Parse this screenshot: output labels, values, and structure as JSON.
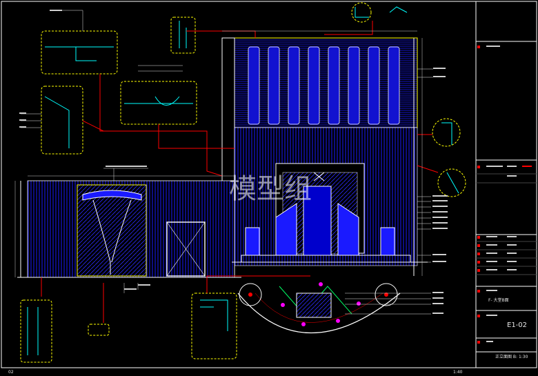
{
  "watermark": "模型组",
  "drawing_number": "E1-02",
  "scale_label": "1:40",
  "sheet_tab": "02",
  "title_block": {
    "project_label": "F- 大堂B面",
    "sheet_name": "E1-02",
    "scale_text": "正立面图 B: 1:30"
  },
  "colors": {
    "background": "#000000",
    "frame": "#ffffff",
    "outline_yellow": "#ffff00",
    "hatch_blue": "#0000ff",
    "leader_red": "#ff0000",
    "accent_magenta": "#ff00ff",
    "text_cyan": "#00ffff"
  }
}
